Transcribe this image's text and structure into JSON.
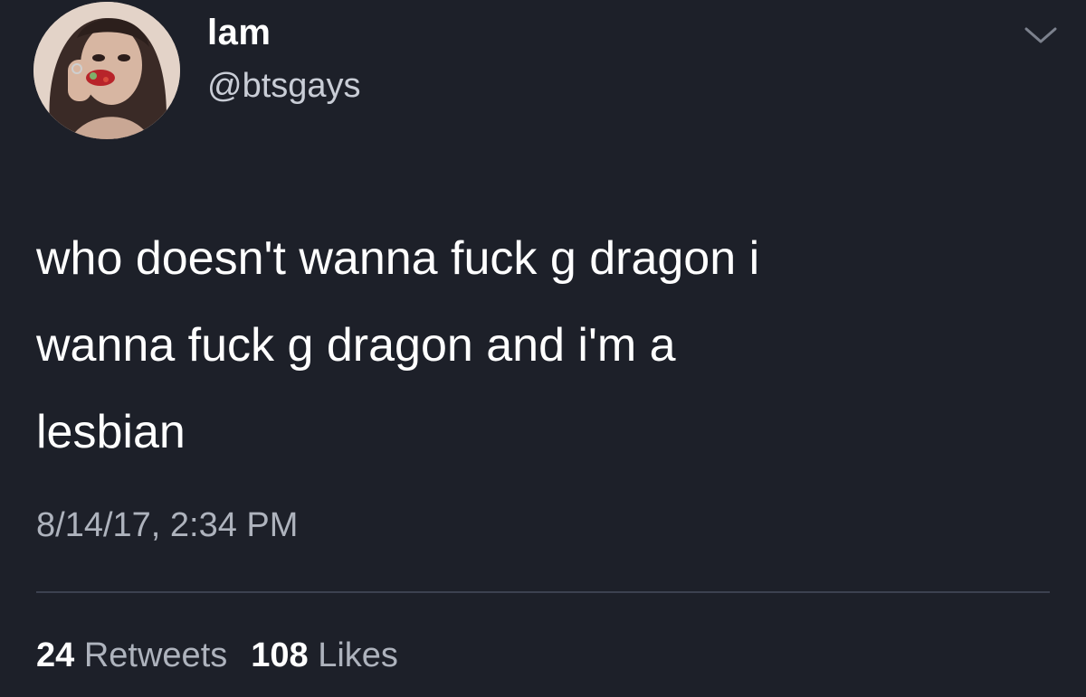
{
  "user": {
    "display_name": "lam",
    "handle": "@btsgays"
  },
  "icons": {
    "avatar": "profile-photo",
    "menu": "chevron-down-icon"
  },
  "tweet": {
    "text": "who doesn't wanna fuck g dragon i\nwanna fuck g dragon and i'm a\nlesbian",
    "timestamp": "8/14/17, 2:34 PM"
  },
  "stats": {
    "retweets_count": "24",
    "retweets_label": "Retweets",
    "likes_count": "108",
    "likes_label": "Likes"
  },
  "colors": {
    "background": "#1d2029",
    "text": "#ffffff",
    "secondary_text": "#aeb3bd",
    "divider": "#3c4150"
  }
}
